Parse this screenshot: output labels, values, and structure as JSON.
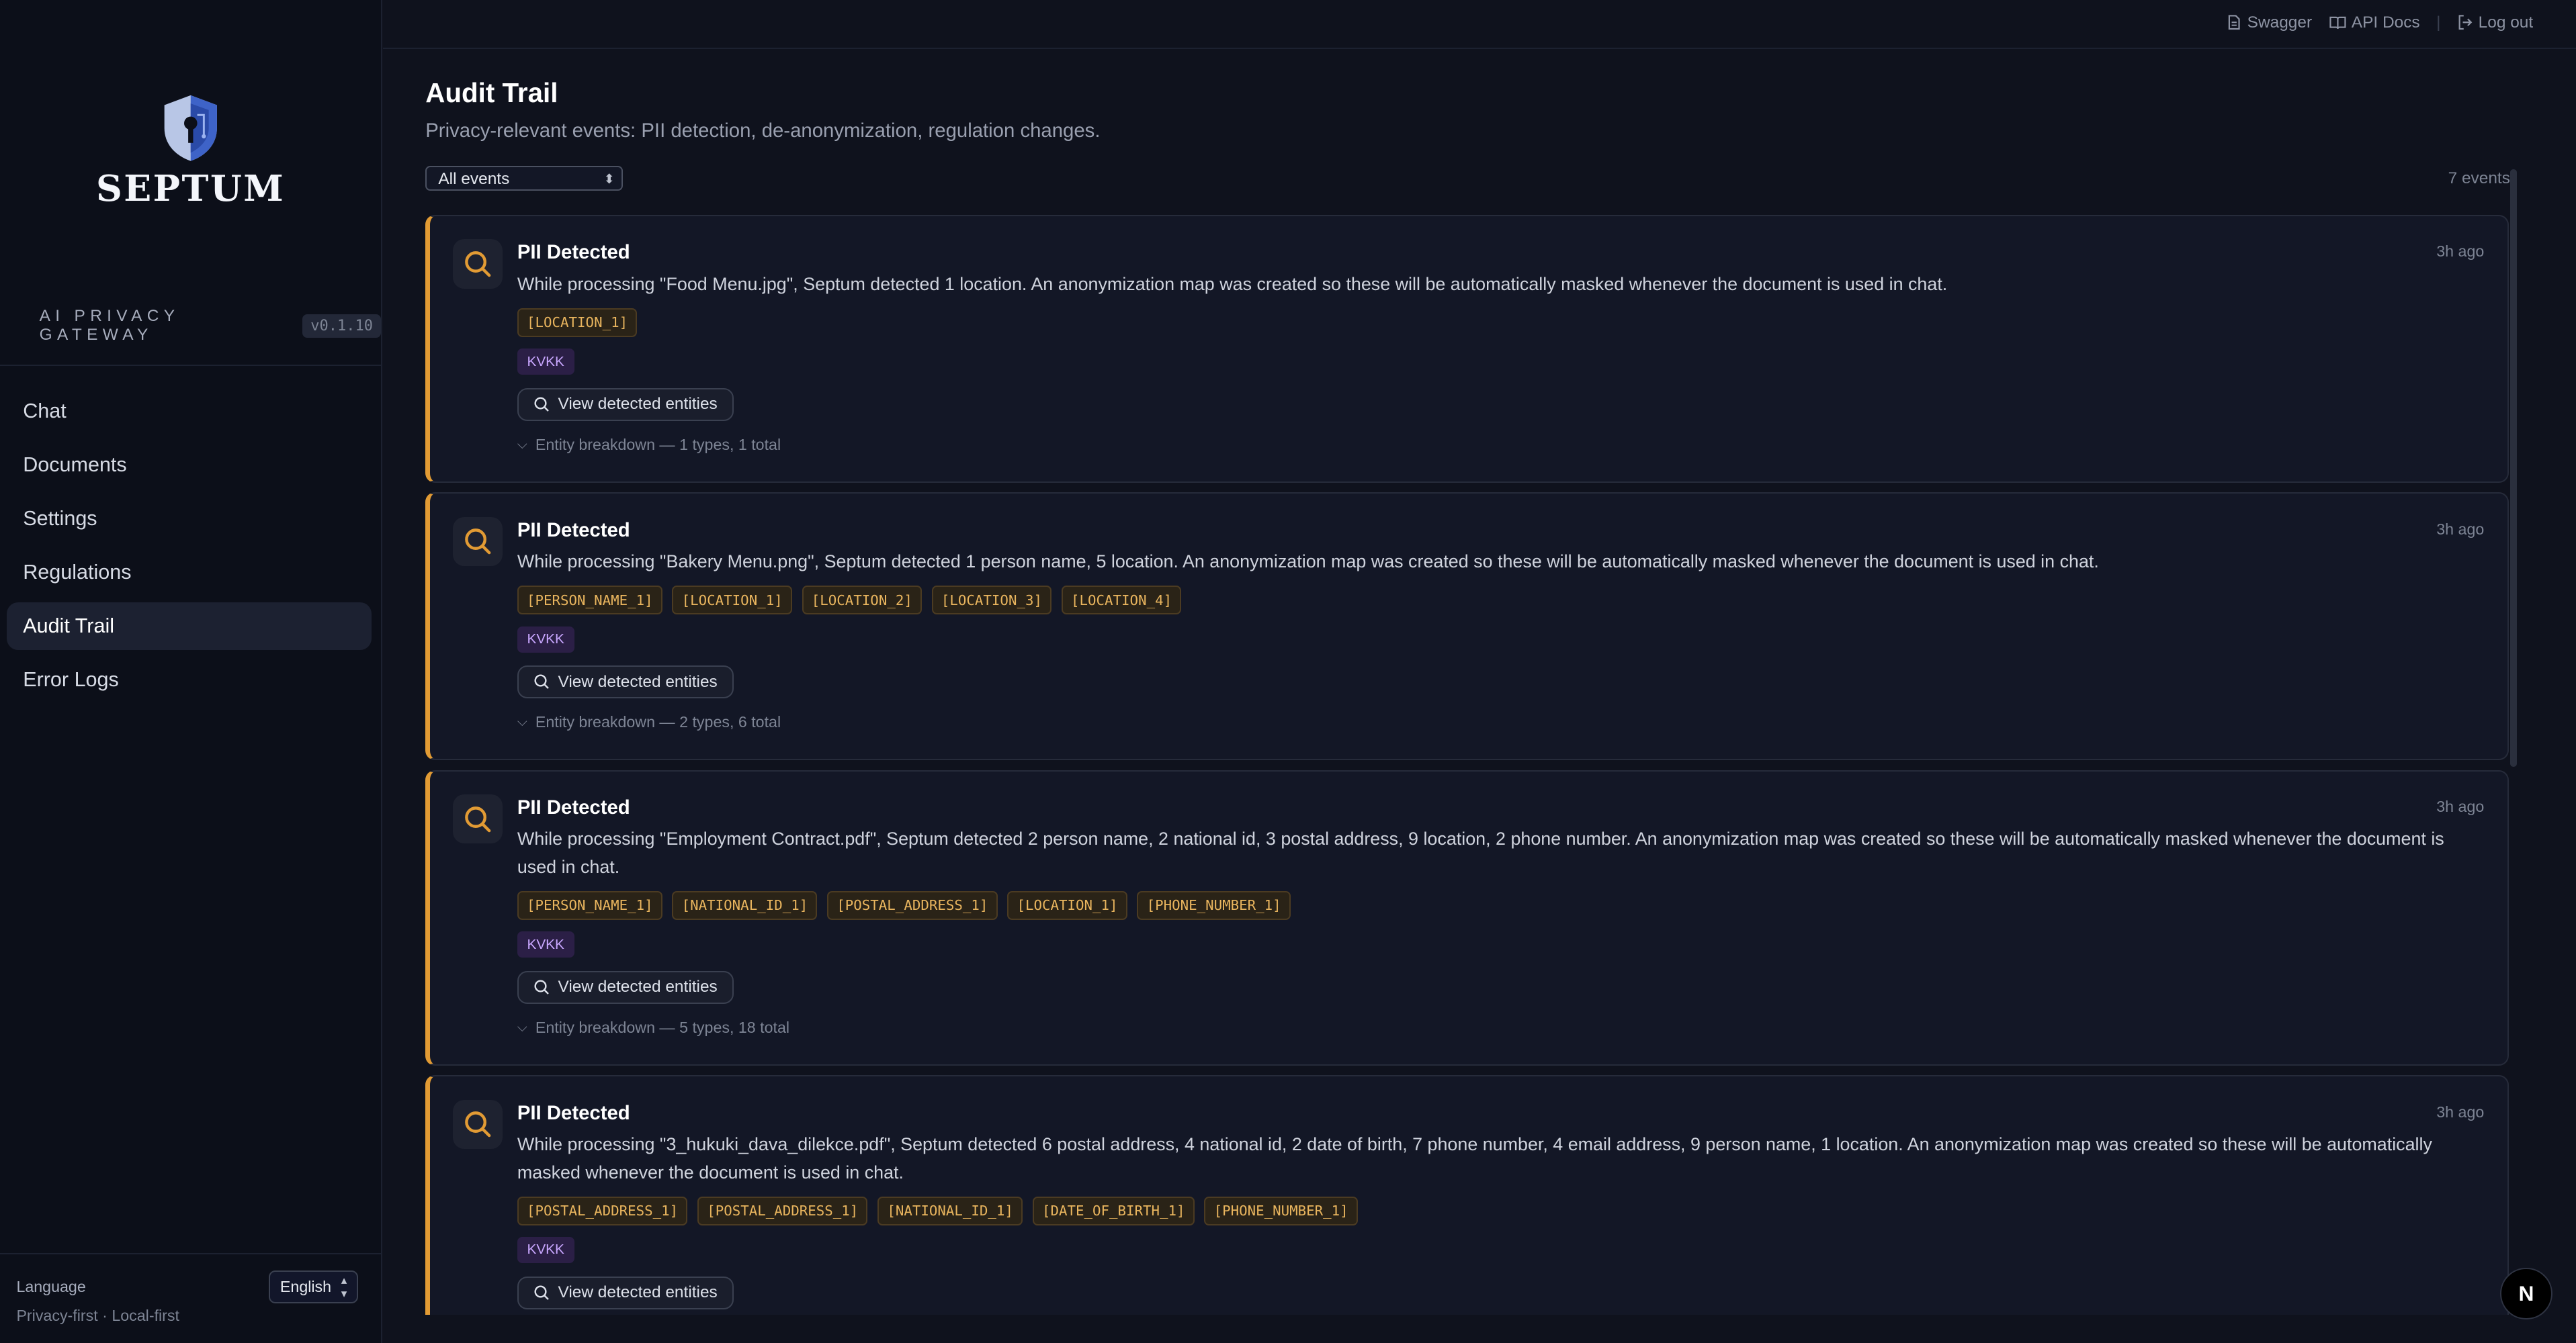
{
  "sidebar": {
    "brand": "SEPTUM",
    "tagline": "AI PRIVACY GATEWAY",
    "version": "v0.1.10",
    "items": [
      {
        "label": "Chat"
      },
      {
        "label": "Documents"
      },
      {
        "label": "Settings"
      },
      {
        "label": "Regulations"
      },
      {
        "label": "Audit Trail"
      },
      {
        "label": "Error Logs"
      }
    ],
    "language_label": "Language",
    "language_value": "English",
    "footnote": "Privacy-first · Local-first"
  },
  "topbar": {
    "swagger": "Swagger",
    "api_docs": "API Docs",
    "logout": "Log out"
  },
  "main": {
    "title": "Audit Trail",
    "subtitle": "Privacy-relevant events: PII detection, de-anonymization, regulation changes.",
    "filter_value": "All events",
    "event_count": "7 events",
    "events": [
      {
        "title": "PII Detected",
        "time": "3h ago",
        "description": "While processing \"Food Menu.jpg\", Septum detected 1 location. An anonymization map was created so these will be automatically masked whenever the document is used in chat.",
        "tags": [
          "[LOCATION_1]"
        ],
        "badge": "KVKK",
        "button": "View detected entities",
        "breakdown": "Entity breakdown — 1 types, 1 total"
      },
      {
        "title": "PII Detected",
        "time": "3h ago",
        "description": "While processing \"Bakery Menu.png\", Septum detected 1 person name, 5 location. An anonymization map was created so these will be automatically masked whenever the document is used in chat.",
        "tags": [
          "[PERSON_NAME_1]",
          "[LOCATION_1]",
          "[LOCATION_2]",
          "[LOCATION_3]",
          "[LOCATION_4]"
        ],
        "badge": "KVKK",
        "button": "View detected entities",
        "breakdown": "Entity breakdown — 2 types, 6 total"
      },
      {
        "title": "PII Detected",
        "time": "3h ago",
        "description": "While processing \"Employment Contract.pdf\", Septum detected 2 person name, 2 national id, 3 postal address, 9 location, 2 phone number. An anonymization map was created so these will be automatically masked whenever the document is used in chat.",
        "tags": [
          "[PERSON_NAME_1]",
          "[NATIONAL_ID_1]",
          "[POSTAL_ADDRESS_1]",
          "[LOCATION_1]",
          "[PHONE_NUMBER_1]"
        ],
        "badge": "KVKK",
        "button": "View detected entities",
        "breakdown": "Entity breakdown — 5 types, 18 total"
      },
      {
        "title": "PII Detected",
        "time": "3h ago",
        "description": "While processing \"3_hukuki_dava_dilekce.pdf\", Septum detected 6 postal address, 4 national id, 2 date of birth, 7 phone number, 4 email address, 9 person name, 1 location. An anonymization map was created so these will be automatically masked whenever the document is used in chat.",
        "tags": [
          "[POSTAL_ADDRESS_1]",
          "[POSTAL_ADDRESS_1]",
          "[NATIONAL_ID_1]",
          "[DATE_OF_BIRTH_1]",
          "[PHONE_NUMBER_1]"
        ],
        "badge": "KVKK",
        "button": "View detected entities"
      }
    ]
  },
  "fab_label": "N",
  "colors": {
    "accent": "#e29b34",
    "background": "#0f121d",
    "sidebar": "#0c0f19",
    "badge": "#c9a7ff"
  }
}
